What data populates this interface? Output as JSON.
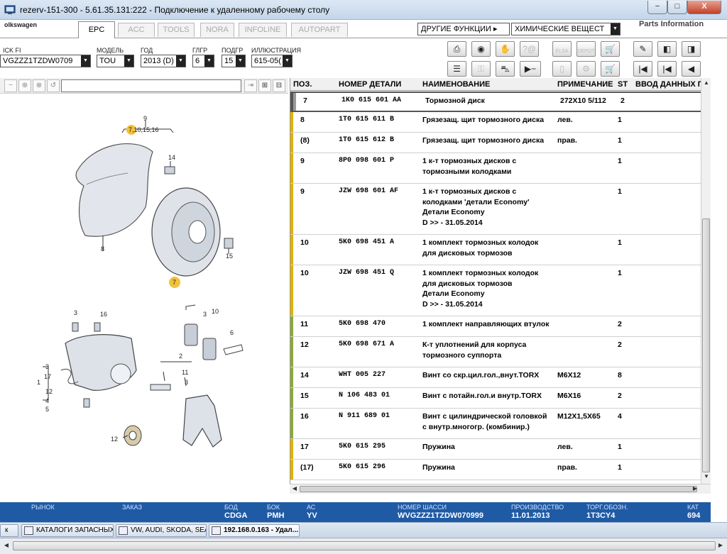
{
  "window": {
    "title": "rezerv-151-300 - 5.61.35.131:222 - Подключение к удаленному рабочему столу",
    "min": "−",
    "max": "□",
    "close": "X"
  },
  "header": {
    "brand": "olkswagen",
    "tabs": [
      "EPC",
      "ACC",
      "TOOLS",
      "NORA",
      "INFOLINE",
      "AUTOPART"
    ],
    "other_functions": "ДРУГИЕ ФУНКЦИИ ▸",
    "chemical": "ХИМИЧЕСКИЕ ВЕЩЕСТ",
    "parts_info": "Parts Information"
  },
  "filters": {
    "quick": {
      "label": "ICK FI",
      "value": "VGZZZ1TZDW0709"
    },
    "model": {
      "label": "МОДЕЛЬ",
      "value": "TOU"
    },
    "year": {
      "label": "ГОД",
      "value": "2013 (D)"
    },
    "group": {
      "label": "ГЛГР",
      "value": "6"
    },
    "subgroup": {
      "label": "ПОДГР",
      "value": "15"
    },
    "illustration": {
      "label": "ИЛЛЮСТРАЦИЯ",
      "value": "615-05("
    }
  },
  "toolbar_icons": [
    "print-icon",
    "coin-icon",
    "handshake-icon",
    "unknown-part-icon",
    "elsa-icon",
    "depot-icon",
    "cart-add-icon",
    "pin-icon",
    "prev-page-icon",
    "next-page-icon",
    "list-icon",
    "key-icon",
    "car-icon",
    "play-minus-icon",
    "phone-icon",
    "tool-icon",
    "cart-icon",
    "first-icon",
    "prev-icon",
    "back-icon"
  ],
  "toolbar_labels": {
    "elsa": "ELSA",
    "depot": "DEPOT"
  },
  "grid": {
    "headers": [
      "ПОЗ.",
      "НОМЕР ДЕТАЛИ",
      "НАИМЕНОВАНИЕ",
      "ПРИМЕЧАНИЕ",
      "ST",
      "ВВОД ДАННЫХ ПО"
    ],
    "rows": [
      {
        "pos": "7",
        "part": "1K0  615  601  AA",
        "name": "Тормозной диск",
        "note": "272X10   5/112",
        "st": "2",
        "color": "#999999"
      },
      {
        "pos": "8",
        "part": "1T0  615  611  B",
        "name": "Грязезащ. щит тормозного диска",
        "note": "лев.",
        "st": "1",
        "color": "#e0b100"
      },
      {
        "pos": "(8)",
        "part": "1T0  615  612  B",
        "name": "Грязезащ. щит тормозного диска",
        "note": "прав.",
        "st": "1",
        "color": "#e0b100"
      },
      {
        "pos": "9",
        "part": "8P0  098  601  P",
        "name": "1 к-т тормозных дисков с\nтормозными колодками",
        "note": "",
        "st": "1",
        "color": "#e0b100"
      },
      {
        "pos": "9",
        "part": "JZW  698  601  AF",
        "name": "1 к-т тормозных дисков с\nколодками    'детали Economy'\nДетали Economy\nD              >> - 31.05.2014",
        "note": "",
        "st": "1",
        "color": "#e0b100"
      },
      {
        "pos": "10",
        "part": "5K0  698  451  A",
        "name": "1 комплект тормозных колодок\nдля дисковых тормозов",
        "note": "",
        "st": "1",
        "color": "#e0b100"
      },
      {
        "pos": "10",
        "part": "JZW  698  451  Q",
        "name": "1 комплект тормозных колодок\nдля дисковых тормозов\nДетали Economy\nD              >> - 31.05.2014",
        "note": "",
        "st": "1",
        "color": "#e0b100"
      },
      {
        "pos": "11",
        "part": "5K0  698  470",
        "name": "1 комплект направляющих втулок",
        "note": "",
        "st": "2",
        "color": "#8aa83a"
      },
      {
        "pos": "12",
        "part": "5K0  698  671  A",
        "name": "К-т уплотнений для корпуса\nтормозного суппорта",
        "note": "",
        "st": "2",
        "color": "#8aa83a"
      },
      {
        "pos": "14",
        "part": "WHT  005  227",
        "name": "Винт со скр.цил.гол.,внут.TORX",
        "note": "M6X12",
        "st": "8",
        "color": "#8aa83a"
      },
      {
        "pos": "15",
        "part": "N     106  483  01",
        "name": "Винт с потайн.гол.и внутр.TORX",
        "note": "M6X16",
        "st": "2",
        "color": "#8aa83a"
      },
      {
        "pos": "16",
        "part": "N     911  689  01",
        "name": "Винт с цилиндрической головкой\nс внутр.многогр. (комбинир.)",
        "note": "M12X1,5X65",
        "st": "4",
        "color": "#8aa83a"
      },
      {
        "pos": "17",
        "part": "5K0  615  295",
        "name": "Пружина",
        "note": "лев.",
        "st": "1",
        "color": "#e0b100"
      },
      {
        "pos": "(17)",
        "part": "5K0  615  296",
        "name": "Пружина",
        "note": "прав.",
        "st": "1",
        "color": "#e0b100"
      }
    ]
  },
  "diagram": {
    "labels": [
      "9",
      "7,10,15,16",
      "14",
      "8",
      "15",
      "7",
      "3",
      "16",
      "10",
      "3",
      "2",
      "6",
      "1",
      "3",
      "17",
      "12",
      "4",
      "5",
      "11",
      "3",
      "12"
    ]
  },
  "status": {
    "market": {
      "label": "РЫНОК",
      "value": ""
    },
    "order": {
      "label": "ЗАКАЗ",
      "value": ""
    },
    "engine": {
      "label": "БОД",
      "value": "CDGA"
    },
    "gearbox": {
      "label": "БОК",
      "value": "PMH"
    },
    "ac": {
      "label": "АС",
      "value": "YV"
    },
    "chassis": {
      "label": "НОМЕР ШАССИ",
      "value": "WVGZZZ1TZDW070999"
    },
    "production": {
      "label": "ПРОИЗВОДСТВО",
      "value": "11.01.2013"
    },
    "trade": {
      "label": "ТОРГ.ОБОЗН.",
      "value": "1T3CY4"
    },
    "cat": {
      "label": "КАТ",
      "value": "694"
    }
  },
  "taskbar": [
    {
      "label": "к"
    },
    {
      "label": "КАТАЛОГИ ЗАПАСНЫХ ..."
    },
    {
      "label": "VW, AUDI, SKODA, SEAT"
    },
    {
      "label": "192.168.0.163 - Удал..."
    }
  ]
}
